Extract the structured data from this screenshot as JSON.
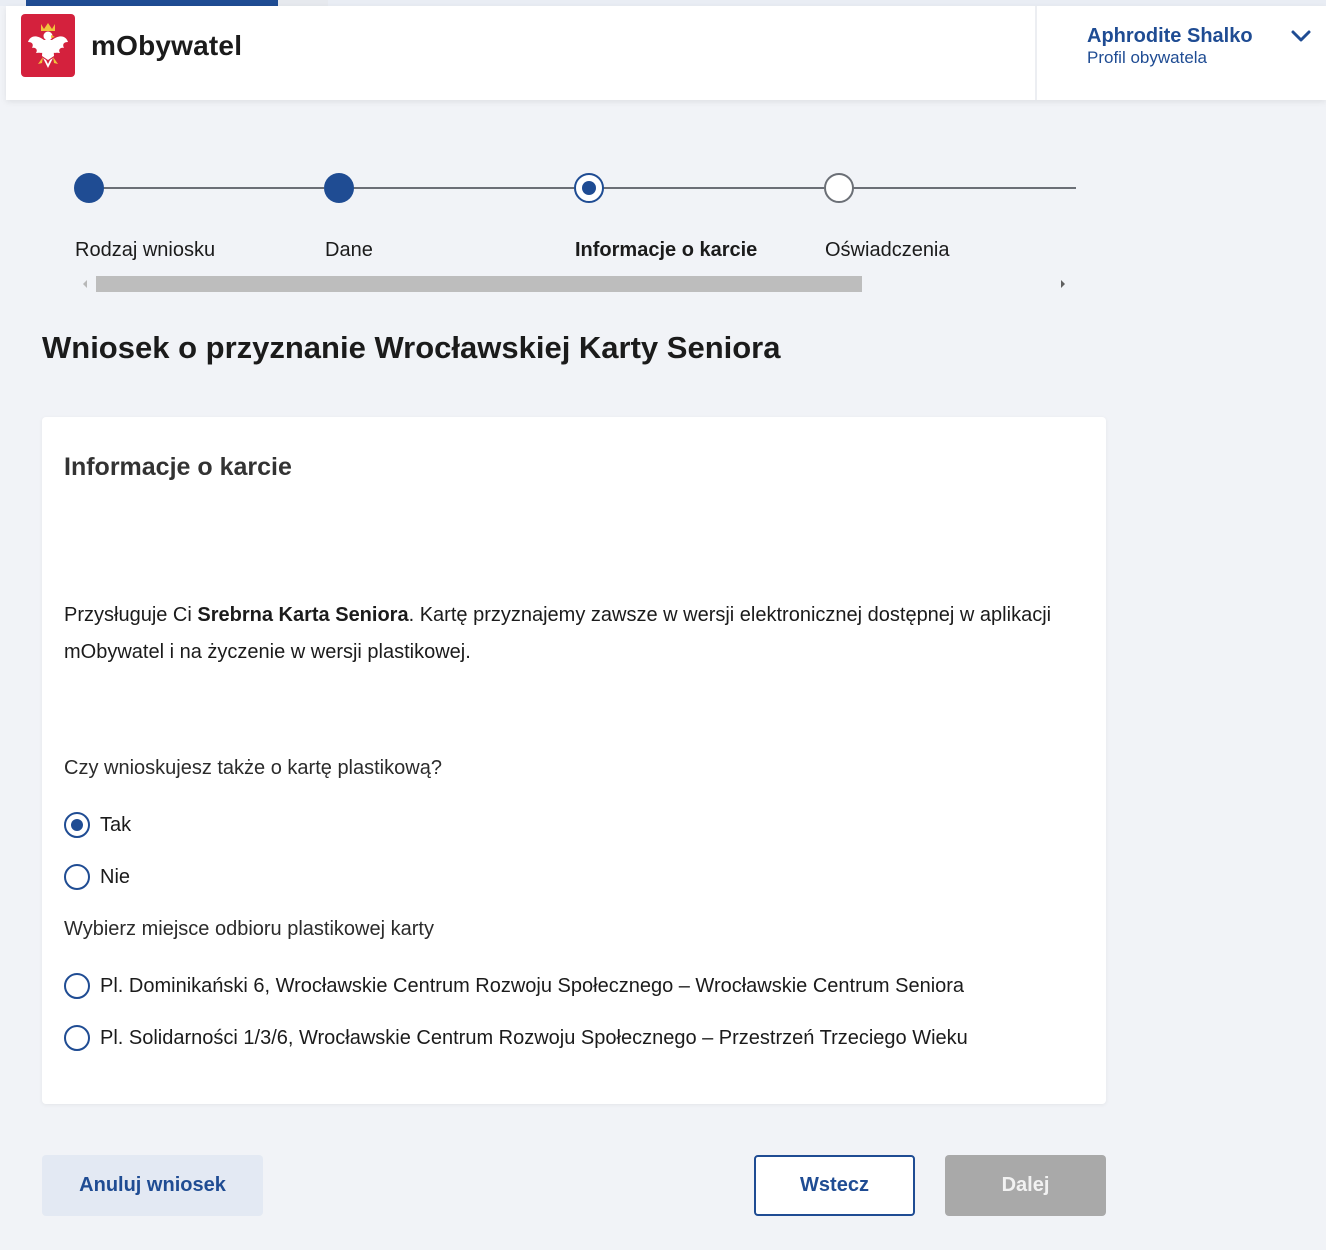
{
  "header": {
    "app_name": "mObywatel",
    "user_name": "Aphrodite Shalko",
    "user_role": "Profil obywatela"
  },
  "steps": [
    {
      "label": "Rodzaj wniosku",
      "state": "done"
    },
    {
      "label": "Dane",
      "state": "done"
    },
    {
      "label": "Informacje o karcie",
      "state": "current"
    },
    {
      "label": "Oświadczenia",
      "state": "todo"
    }
  ],
  "page": {
    "title": "Wniosek o przyznanie Wrocławskiej Karty Seniora"
  },
  "card": {
    "title": "Informacje o karcie",
    "text_before": "Przysługuje Ci ",
    "text_bold": "Srebrna Karta Seniora",
    "text_after": ". Kartę przyznajemy zawsze w wersji elektronicznej dostępnej w aplikacji mObywatel i na życzenie w wersji plastikowej.",
    "question_plastic": "Czy wnioskujesz także o kartę plastikową?",
    "option_yes": "Tak",
    "option_no": "Nie",
    "selected_plastic": "Tak",
    "question_pickup": "Wybierz miejsce odbioru plastikowej karty",
    "pickup_1": "Pl. Dominikański 6, Wrocławskie Centrum Rozwoju Społecznego – Wrocławskie Centrum Seniora",
    "pickup_2": "Pl. Solidarności 1/3/6, Wrocławskie Centrum Rozwoju Społecznego – Przestrzeń Trzeciego Wieku"
  },
  "buttons": {
    "cancel": "Anuluj wniosek",
    "back": "Wstecz",
    "next": "Dalej"
  },
  "colors": {
    "primary": "#1f4c93",
    "background": "#f1f3f7",
    "brand_red": "#d4213d",
    "disabled": "#a9a9a9"
  }
}
